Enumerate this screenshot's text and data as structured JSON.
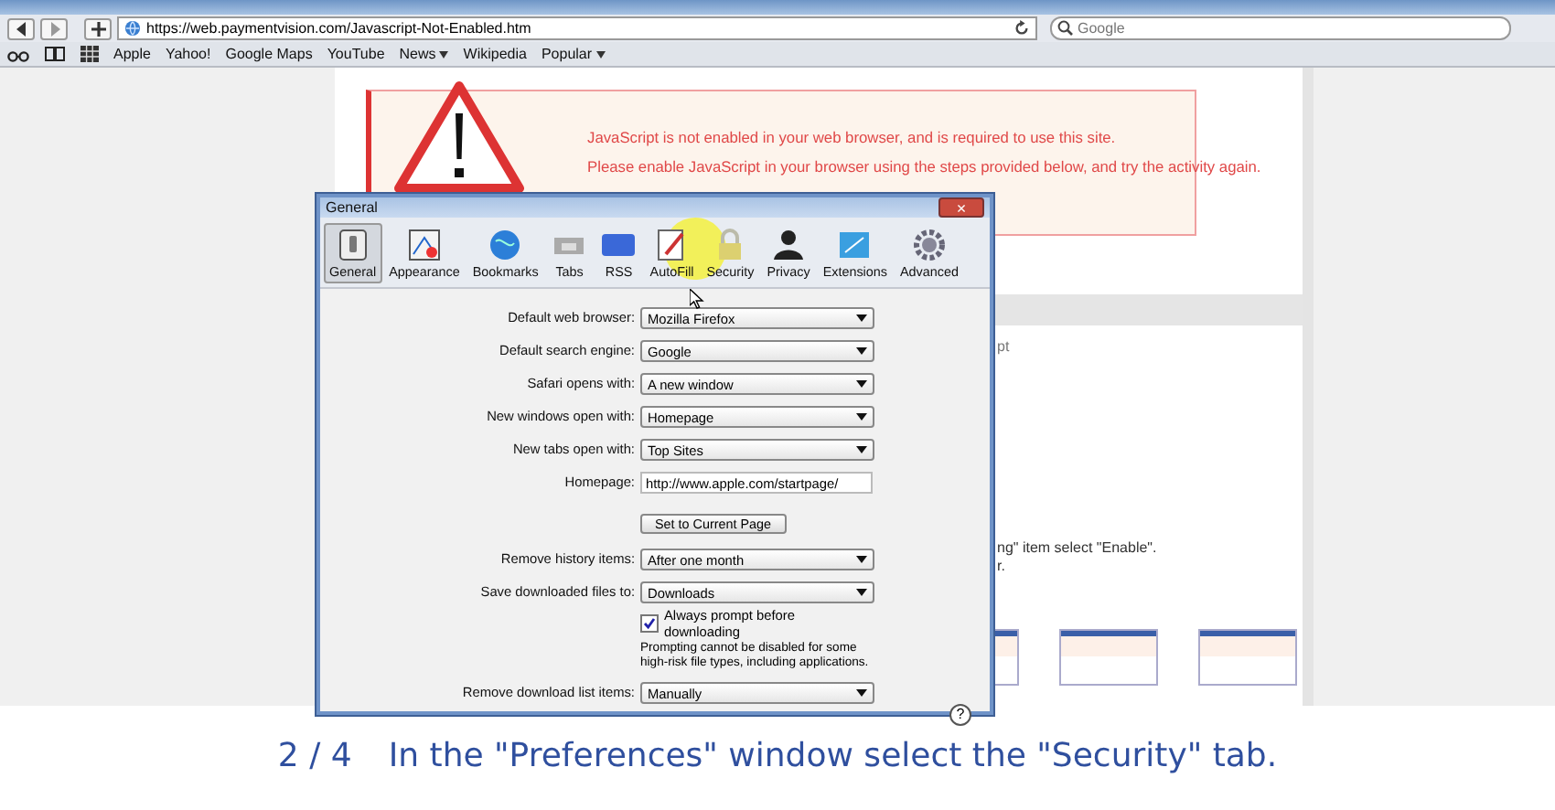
{
  "browser": {
    "url": "https://web.paymentvision.com/Javascript-Not-Enabled.htm",
    "search": {
      "placeholder": "Google"
    },
    "bookmarks": [
      {
        "label": "Apple",
        "menu": false
      },
      {
        "label": "Yahoo!",
        "menu": false
      },
      {
        "label": "Google Maps",
        "menu": false
      },
      {
        "label": "YouTube",
        "menu": false
      },
      {
        "label": "News",
        "menu": true
      },
      {
        "label": "Wikipedia",
        "menu": false
      },
      {
        "label": "Popular",
        "menu": true
      }
    ]
  },
  "warning": {
    "lines": [
      "JavaScript is not enabled in your web browser, and is required to use this site.",
      "Please enable JavaScript in your browser using the steps provided below, and try the activity again."
    ]
  },
  "page_fragments": [
    "pt",
    "ng\" item select \"Enable\".",
    "r."
  ],
  "dialog": {
    "title": "General",
    "close": "×",
    "tabs": [
      {
        "label": "General",
        "selected": true
      },
      {
        "label": "Appearance",
        "selected": false
      },
      {
        "label": "Bookmarks",
        "selected": false
      },
      {
        "label": "Tabs",
        "selected": false
      },
      {
        "label": "RSS",
        "selected": false
      },
      {
        "label": "AutoFill",
        "selected": false
      },
      {
        "label": "Security",
        "selected": false
      },
      {
        "label": "Privacy",
        "selected": false
      },
      {
        "label": "Extensions",
        "selected": false
      },
      {
        "label": "Advanced",
        "selected": false
      }
    ],
    "settings": [
      {
        "kind": "select",
        "label": "Default web browser:",
        "value": "Mozilla Firefox"
      },
      {
        "kind": "select",
        "label": "Default search engine:",
        "value": "Google"
      },
      {
        "kind": "select",
        "label": "Safari opens with:",
        "value": "A new window"
      },
      {
        "kind": "select",
        "label": "New windows open with:",
        "value": "Homepage"
      },
      {
        "kind": "select",
        "label": "New tabs open with:",
        "value": "Top Sites"
      },
      {
        "kind": "text",
        "label": "Homepage:",
        "value": "http://www.apple.com/startpage/"
      },
      {
        "kind": "button",
        "label": "Set to Current Page"
      },
      {
        "kind": "select",
        "label": "Remove history items:",
        "value": "After one month"
      },
      {
        "kind": "select",
        "label": "Save downloaded files to:",
        "value": "Downloads"
      },
      {
        "kind": "checkbox",
        "label": "Always prompt before downloading",
        "checked": true,
        "note": "Prompting cannot be disabled for some high-risk file types, including applications."
      },
      {
        "kind": "select",
        "label": "Remove download list items:",
        "value": "Manually"
      }
    ],
    "help": "?"
  },
  "caption": {
    "step": "2 / 4",
    "text": "In the \"Preferences\" window select the \"Security\" tab."
  }
}
